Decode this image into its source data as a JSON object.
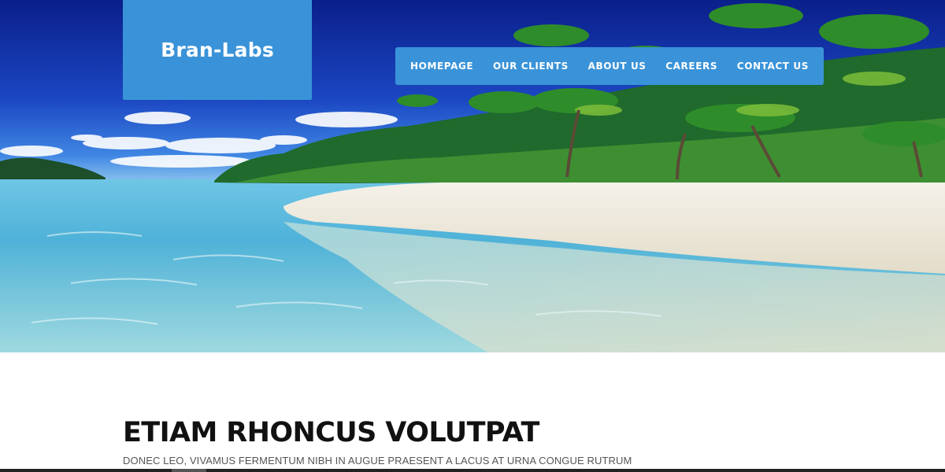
{
  "brand": {
    "logo_text": "Bran-Labs",
    "accent_color": "#3a93d8"
  },
  "nav": {
    "items": [
      {
        "label": "HOMEPAGE"
      },
      {
        "label": "OUR CLIENTS"
      },
      {
        "label": "ABOUT US"
      },
      {
        "label": "CAREERS"
      },
      {
        "label": "CONTACT US"
      }
    ]
  },
  "hero": {
    "image_icon": "tropical-beach-photo"
  },
  "content": {
    "headline": "ETIAM RHONCUS VOLUTPAT",
    "subline": "DONEC LEO, VIVAMUS FERMENTUM NIBH IN AUGUE PRAESENT A LACUS AT URNA CONGUE RUTRUM"
  }
}
